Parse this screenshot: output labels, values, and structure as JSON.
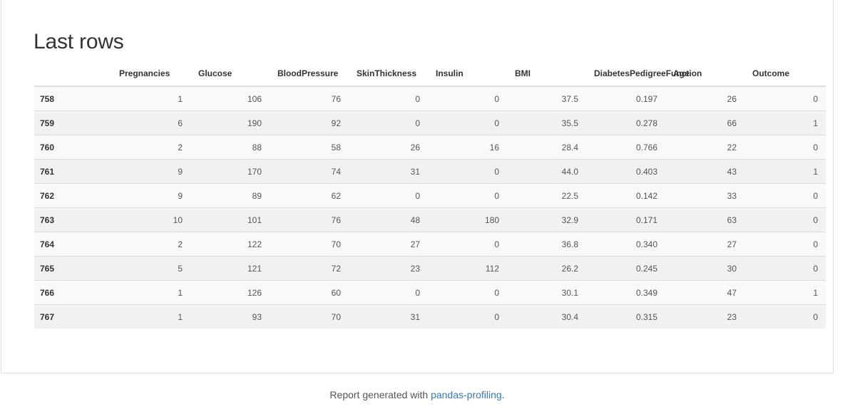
{
  "section": {
    "title": "Last rows"
  },
  "table": {
    "columns": [
      "",
      "Pregnancies",
      "Glucose",
      "BloodPressure",
      "SkinThickness",
      "Insulin",
      "BMI",
      "DiabetesPedigreeFunction",
      "Age",
      "Outcome"
    ],
    "rows": [
      [
        "758",
        "1",
        "106",
        "76",
        "0",
        "0",
        "37.5",
        "0.197",
        "26",
        "0"
      ],
      [
        "759",
        "6",
        "190",
        "92",
        "0",
        "0",
        "35.5",
        "0.278",
        "66",
        "1"
      ],
      [
        "760",
        "2",
        "88",
        "58",
        "26",
        "16",
        "28.4",
        "0.766",
        "22",
        "0"
      ],
      [
        "761",
        "9",
        "170",
        "74",
        "31",
        "0",
        "44.0",
        "0.403",
        "43",
        "1"
      ],
      [
        "762",
        "9",
        "89",
        "62",
        "0",
        "0",
        "22.5",
        "0.142",
        "33",
        "0"
      ],
      [
        "763",
        "10",
        "101",
        "76",
        "48",
        "180",
        "32.9",
        "0.171",
        "63",
        "0"
      ],
      [
        "764",
        "2",
        "122",
        "70",
        "27",
        "0",
        "36.8",
        "0.340",
        "27",
        "0"
      ],
      [
        "765",
        "5",
        "121",
        "72",
        "23",
        "112",
        "26.2",
        "0.245",
        "30",
        "0"
      ],
      [
        "766",
        "1",
        "126",
        "60",
        "0",
        "0",
        "30.1",
        "0.349",
        "47",
        "1"
      ],
      [
        "767",
        "1",
        "93",
        "70",
        "31",
        "0",
        "30.4",
        "0.315",
        "23",
        "0"
      ]
    ]
  },
  "footer": {
    "prefix": "Report generated with ",
    "link_text": "pandas-profiling",
    "suffix": "."
  }
}
